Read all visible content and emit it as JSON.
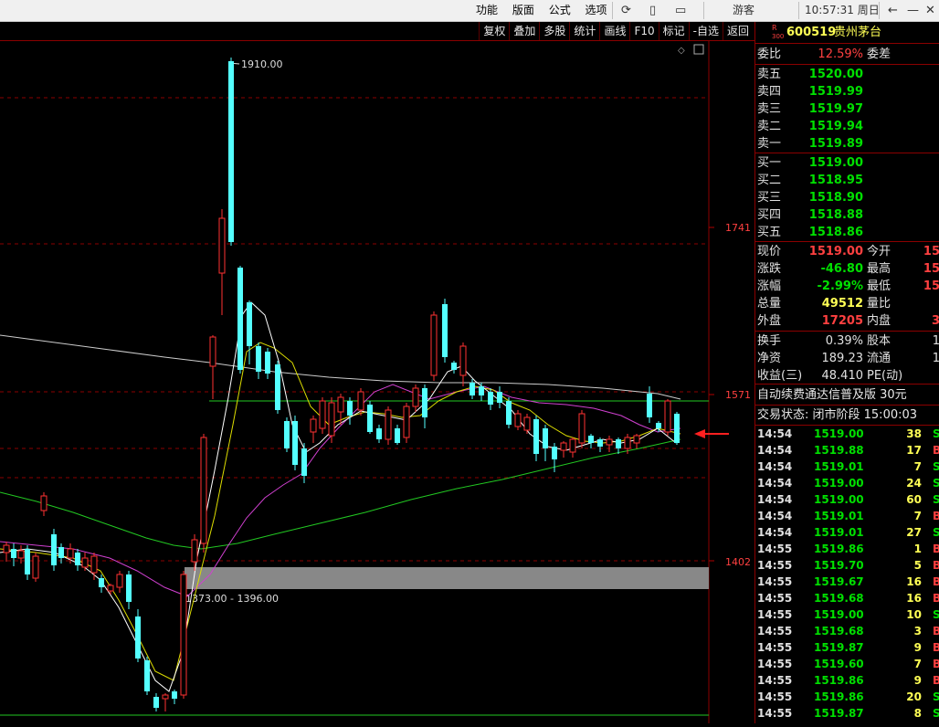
{
  "menu": {
    "items": [
      "功能",
      "版面",
      "公式",
      "选项"
    ],
    "guest": "游客",
    "time": "10:57:31 周日"
  },
  "toolbar": {
    "buttons": [
      "复权",
      "叠加",
      "多股",
      "统计",
      "画线",
      "F10",
      "标记",
      "-自选",
      "返回"
    ]
  },
  "chart": {
    "price_labels": [
      "1910.00",
      "1741",
      "1571",
      "1402",
      "1373.00 - 1396.00"
    ]
  },
  "stock": {
    "badge_top": "R",
    "badge_bottom": "300",
    "code": "600519",
    "name": "贵州茅台"
  },
  "weibi": {
    "label": "委比",
    "value": "12.59%",
    "label2": "委差"
  },
  "asks": [
    {
      "label": "卖五",
      "price": "1520.00"
    },
    {
      "label": "卖四",
      "price": "1519.99"
    },
    {
      "label": "卖三",
      "price": "1519.97"
    },
    {
      "label": "卖二",
      "price": "1519.94"
    },
    {
      "label": "卖一",
      "price": "1519.89"
    }
  ],
  "bids": [
    {
      "label": "买一",
      "price": "1519.00"
    },
    {
      "label": "买二",
      "price": "1518.95"
    },
    {
      "label": "买三",
      "price": "1518.90"
    },
    {
      "label": "买四",
      "price": "1518.88"
    },
    {
      "label": "买五",
      "price": "1518.86"
    }
  ],
  "quote": [
    {
      "label": "现价",
      "value": "1519.00",
      "label2": "今开",
      "value2": "15",
      "color": "#ff4040"
    },
    {
      "label": "涨跌",
      "value": "-46.80",
      "label2": "最高",
      "value2": "15",
      "color": "#00e000"
    },
    {
      "label": "涨幅",
      "value": "-2.99%",
      "label2": "最低",
      "value2": "15",
      "color": "#00e000"
    },
    {
      "label": "总量",
      "value": "49512",
      "label2": "量比",
      "value2": "",
      "color": "#ffff55"
    },
    {
      "label": "外盘",
      "value": "17205",
      "label2": "内盘",
      "value2": "3",
      "color": "#ff4040"
    }
  ],
  "finance": [
    {
      "label": "换手",
      "value": "0.39%",
      "label2": "股本",
      "value2": "1"
    },
    {
      "label": "净资",
      "value": "189.23",
      "label2": "流通",
      "value2": "1"
    },
    {
      "label": "收益(三)",
      "value": "48.410",
      "label2": "PE(动)",
      "value2": ""
    }
  ],
  "ad": "自动续费通达信普及版  30元",
  "trade_status": "交易状态: 闭市阶段 15:00:03",
  "ticks": [
    {
      "t": "14:54",
      "p": "1519.00",
      "v": "38",
      "d": "S",
      "c": "#00e000"
    },
    {
      "t": "14:54",
      "p": "1519.88",
      "v": "17",
      "d": "B",
      "c": "#ff4040"
    },
    {
      "t": "14:54",
      "p": "1519.01",
      "v": "7",
      "d": "S",
      "c": "#00e000"
    },
    {
      "t": "14:54",
      "p": "1519.00",
      "v": "24",
      "d": "S",
      "c": "#00e000"
    },
    {
      "t": "14:54",
      "p": "1519.00",
      "v": "60",
      "d": "S",
      "c": "#00e000"
    },
    {
      "t": "14:54",
      "p": "1519.01",
      "v": "7",
      "d": "B",
      "c": "#ff4040"
    },
    {
      "t": "14:54",
      "p": "1519.01",
      "v": "27",
      "d": "S",
      "c": "#00e000"
    },
    {
      "t": "14:55",
      "p": "1519.86",
      "v": "1",
      "d": "B",
      "c": "#ff4040"
    },
    {
      "t": "14:55",
      "p": "1519.70",
      "v": "5",
      "d": "B",
      "c": "#ff4040"
    },
    {
      "t": "14:55",
      "p": "1519.67",
      "v": "16",
      "d": "B",
      "c": "#ff4040"
    },
    {
      "t": "14:55",
      "p": "1519.68",
      "v": "16",
      "d": "B",
      "c": "#ff4040"
    },
    {
      "t": "14:55",
      "p": "1519.00",
      "v": "10",
      "d": "S",
      "c": "#00e000"
    },
    {
      "t": "14:55",
      "p": "1519.68",
      "v": "3",
      "d": "B",
      "c": "#ff4040"
    },
    {
      "t": "14:55",
      "p": "1519.87",
      "v": "9",
      "d": "B",
      "c": "#ff4040"
    },
    {
      "t": "14:55",
      "p": "1519.60",
      "v": "7",
      "d": "B",
      "c": "#ff4040"
    },
    {
      "t": "14:55",
      "p": "1519.86",
      "v": "9",
      "d": "B",
      "c": "#ff4040"
    },
    {
      "t": "14:55",
      "p": "1519.86",
      "v": "20",
      "d": "S",
      "c": "#00e000"
    },
    {
      "t": "14:55",
      "p": "1519.87",
      "v": "8",
      "d": "S",
      "c": "#00e000"
    }
  ]
}
